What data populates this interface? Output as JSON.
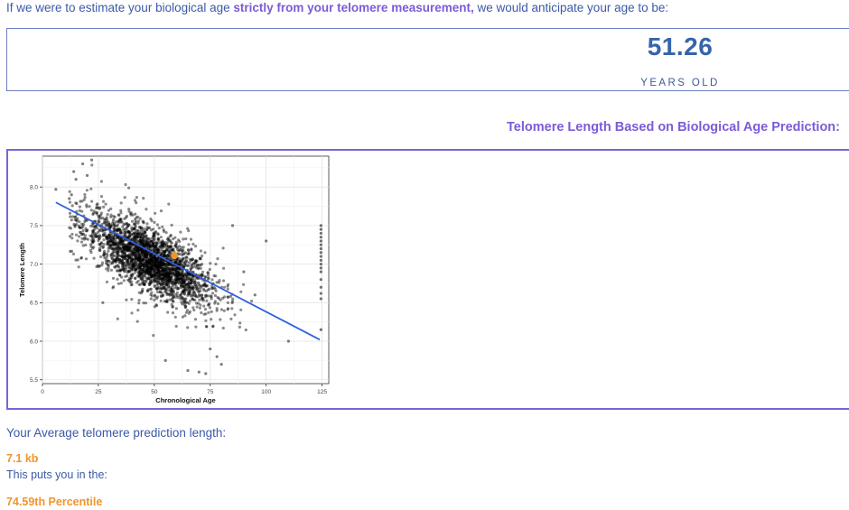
{
  "intro": {
    "before": "If we were to estimate your biological age ",
    "highlight": "strictly from your telomere measurement,",
    "after": " we would anticipate your age to be:"
  },
  "age": {
    "value": "51.26",
    "unit": "YEARS OLD"
  },
  "chart_heading": "Telomere Length Based on Biological Age Prediction:",
  "results": {
    "avg_label": "Your Average telomere prediction length:",
    "avg_value": "7.1 kb",
    "puts_label": "This puts you in the:",
    "percentile_value": "74.59th Percentile"
  },
  "colors": {
    "accent_purple": "#7b5bd6",
    "text_blue": "#3b5aa6",
    "value_blue": "#3564ab",
    "highlight_orange": "#f0952b",
    "trend_line": "#2f5fe0"
  },
  "chart_data": {
    "type": "scatter",
    "title": "",
    "xlabel": "Chronological Age",
    "ylabel": "Telomere Length",
    "xlim": [
      0,
      128
    ],
    "ylim": [
      5.45,
      8.4
    ],
    "x_ticks": [
      0,
      25,
      50,
      75,
      100,
      125
    ],
    "y_ticks": [
      5.5,
      6.0,
      6.5,
      7.0,
      7.5,
      8.0
    ],
    "x_tick_labels": [
      "0",
      "25",
      "50",
      "75",
      "100",
      "125"
    ],
    "y_tick_labels": [
      "5.5",
      "6.0",
      "6.5",
      "7.0",
      "7.5",
      "8.0"
    ],
    "grid": true,
    "point_cloud": {
      "description_free": true,
      "center_x": 48,
      "center_y": 7.05,
      "slope": -0.0148,
      "x_sd": 14,
      "resid_sd": 0.2,
      "count": 2600
    },
    "outliers_at_125": [
      7.5,
      7.45,
      7.4,
      7.35,
      7.3,
      7.25,
      7.2,
      7.15,
      7.1,
      7.05,
      7.0,
      6.95,
      6.9,
      6.8,
      6.7,
      6.62,
      6.55,
      6.15
    ],
    "scattered_points": [
      [
        6,
        7.97
      ],
      [
        14,
        8.2
      ],
      [
        15,
        8.1
      ],
      [
        18,
        8.3
      ],
      [
        22,
        8.35
      ],
      [
        13,
        7.9
      ],
      [
        12,
        7.85
      ],
      [
        20,
        8.15
      ],
      [
        27,
        6.5
      ],
      [
        55,
        5.75
      ],
      [
        65,
        5.62
      ],
      [
        70,
        5.6
      ],
      [
        73,
        5.58
      ],
      [
        80,
        5.7
      ],
      [
        100,
        7.3
      ],
      [
        95,
        6.6
      ],
      [
        90,
        6.9
      ],
      [
        85,
        7.5
      ],
      [
        110,
        6.0
      ],
      [
        75,
        5.9
      ],
      [
        78,
        5.8
      ]
    ],
    "trend_line": {
      "x": [
        6,
        124
      ],
      "y": [
        7.8,
        6.02
      ]
    },
    "highlight_point": {
      "x": 59,
      "y": 7.11
    }
  }
}
